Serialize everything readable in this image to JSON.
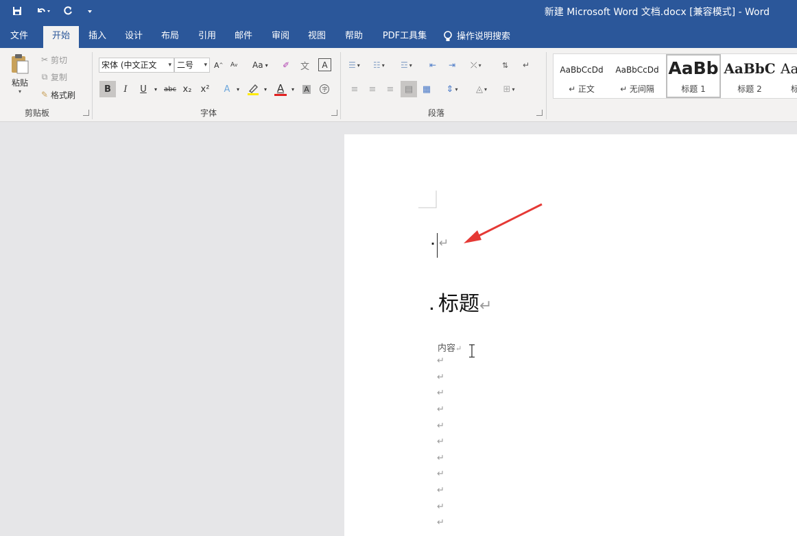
{
  "title_bar": {
    "document_title": "新建 Microsoft Word 文档.docx [兼容模式]  -  Word",
    "quick_access": {
      "save_icon": "save-icon",
      "undo_icon": "undo-icon",
      "redo_icon": "redo-icon"
    }
  },
  "tabs": [
    {
      "label": "文件"
    },
    {
      "label": "开始"
    },
    {
      "label": "插入"
    },
    {
      "label": "设计"
    },
    {
      "label": "布局"
    },
    {
      "label": "引用"
    },
    {
      "label": "邮件"
    },
    {
      "label": "审阅"
    },
    {
      "label": "视图"
    },
    {
      "label": "帮助"
    },
    {
      "label": "PDF工具集"
    }
  ],
  "tell_me": {
    "label": "操作说明搜索"
  },
  "clipboard": {
    "group_label": "剪贴板",
    "paste_label": "粘贴",
    "cut_label": "剪切",
    "copy_label": "复制",
    "format_painter_label": "格式刷"
  },
  "font": {
    "group_label": "字体",
    "font_name": "宋体 (中文正文",
    "font_size": "二号",
    "bold": "B",
    "italic": "I",
    "underline": "U",
    "strike": "abc",
    "subscript": "x₂",
    "superscript": "x²",
    "case": "Aa",
    "grow": "A",
    "shrink": "A",
    "font_color": "A",
    "shading": "A"
  },
  "paragraph": {
    "group_label": "段落"
  },
  "styles": {
    "items": [
      {
        "preview": "AaBbCcDd",
        "name": "↵ 正文"
      },
      {
        "preview": "AaBbCcDd",
        "name": "↵ 无间隔"
      },
      {
        "preview": "AaBb",
        "name": "标题 1"
      },
      {
        "preview": "AaBbC",
        "name": "标题 2"
      },
      {
        "preview": "Aa",
        "name": "标"
      }
    ]
  },
  "document": {
    "line1_mark": "↵",
    "heading": "标题",
    "heading_mark": "↵",
    "content": "内容",
    "content_mark": "↵",
    "empty_mark": "↵"
  },
  "colors": {
    "brand": "#2b579a",
    "annotation_arrow": "#e53935"
  }
}
